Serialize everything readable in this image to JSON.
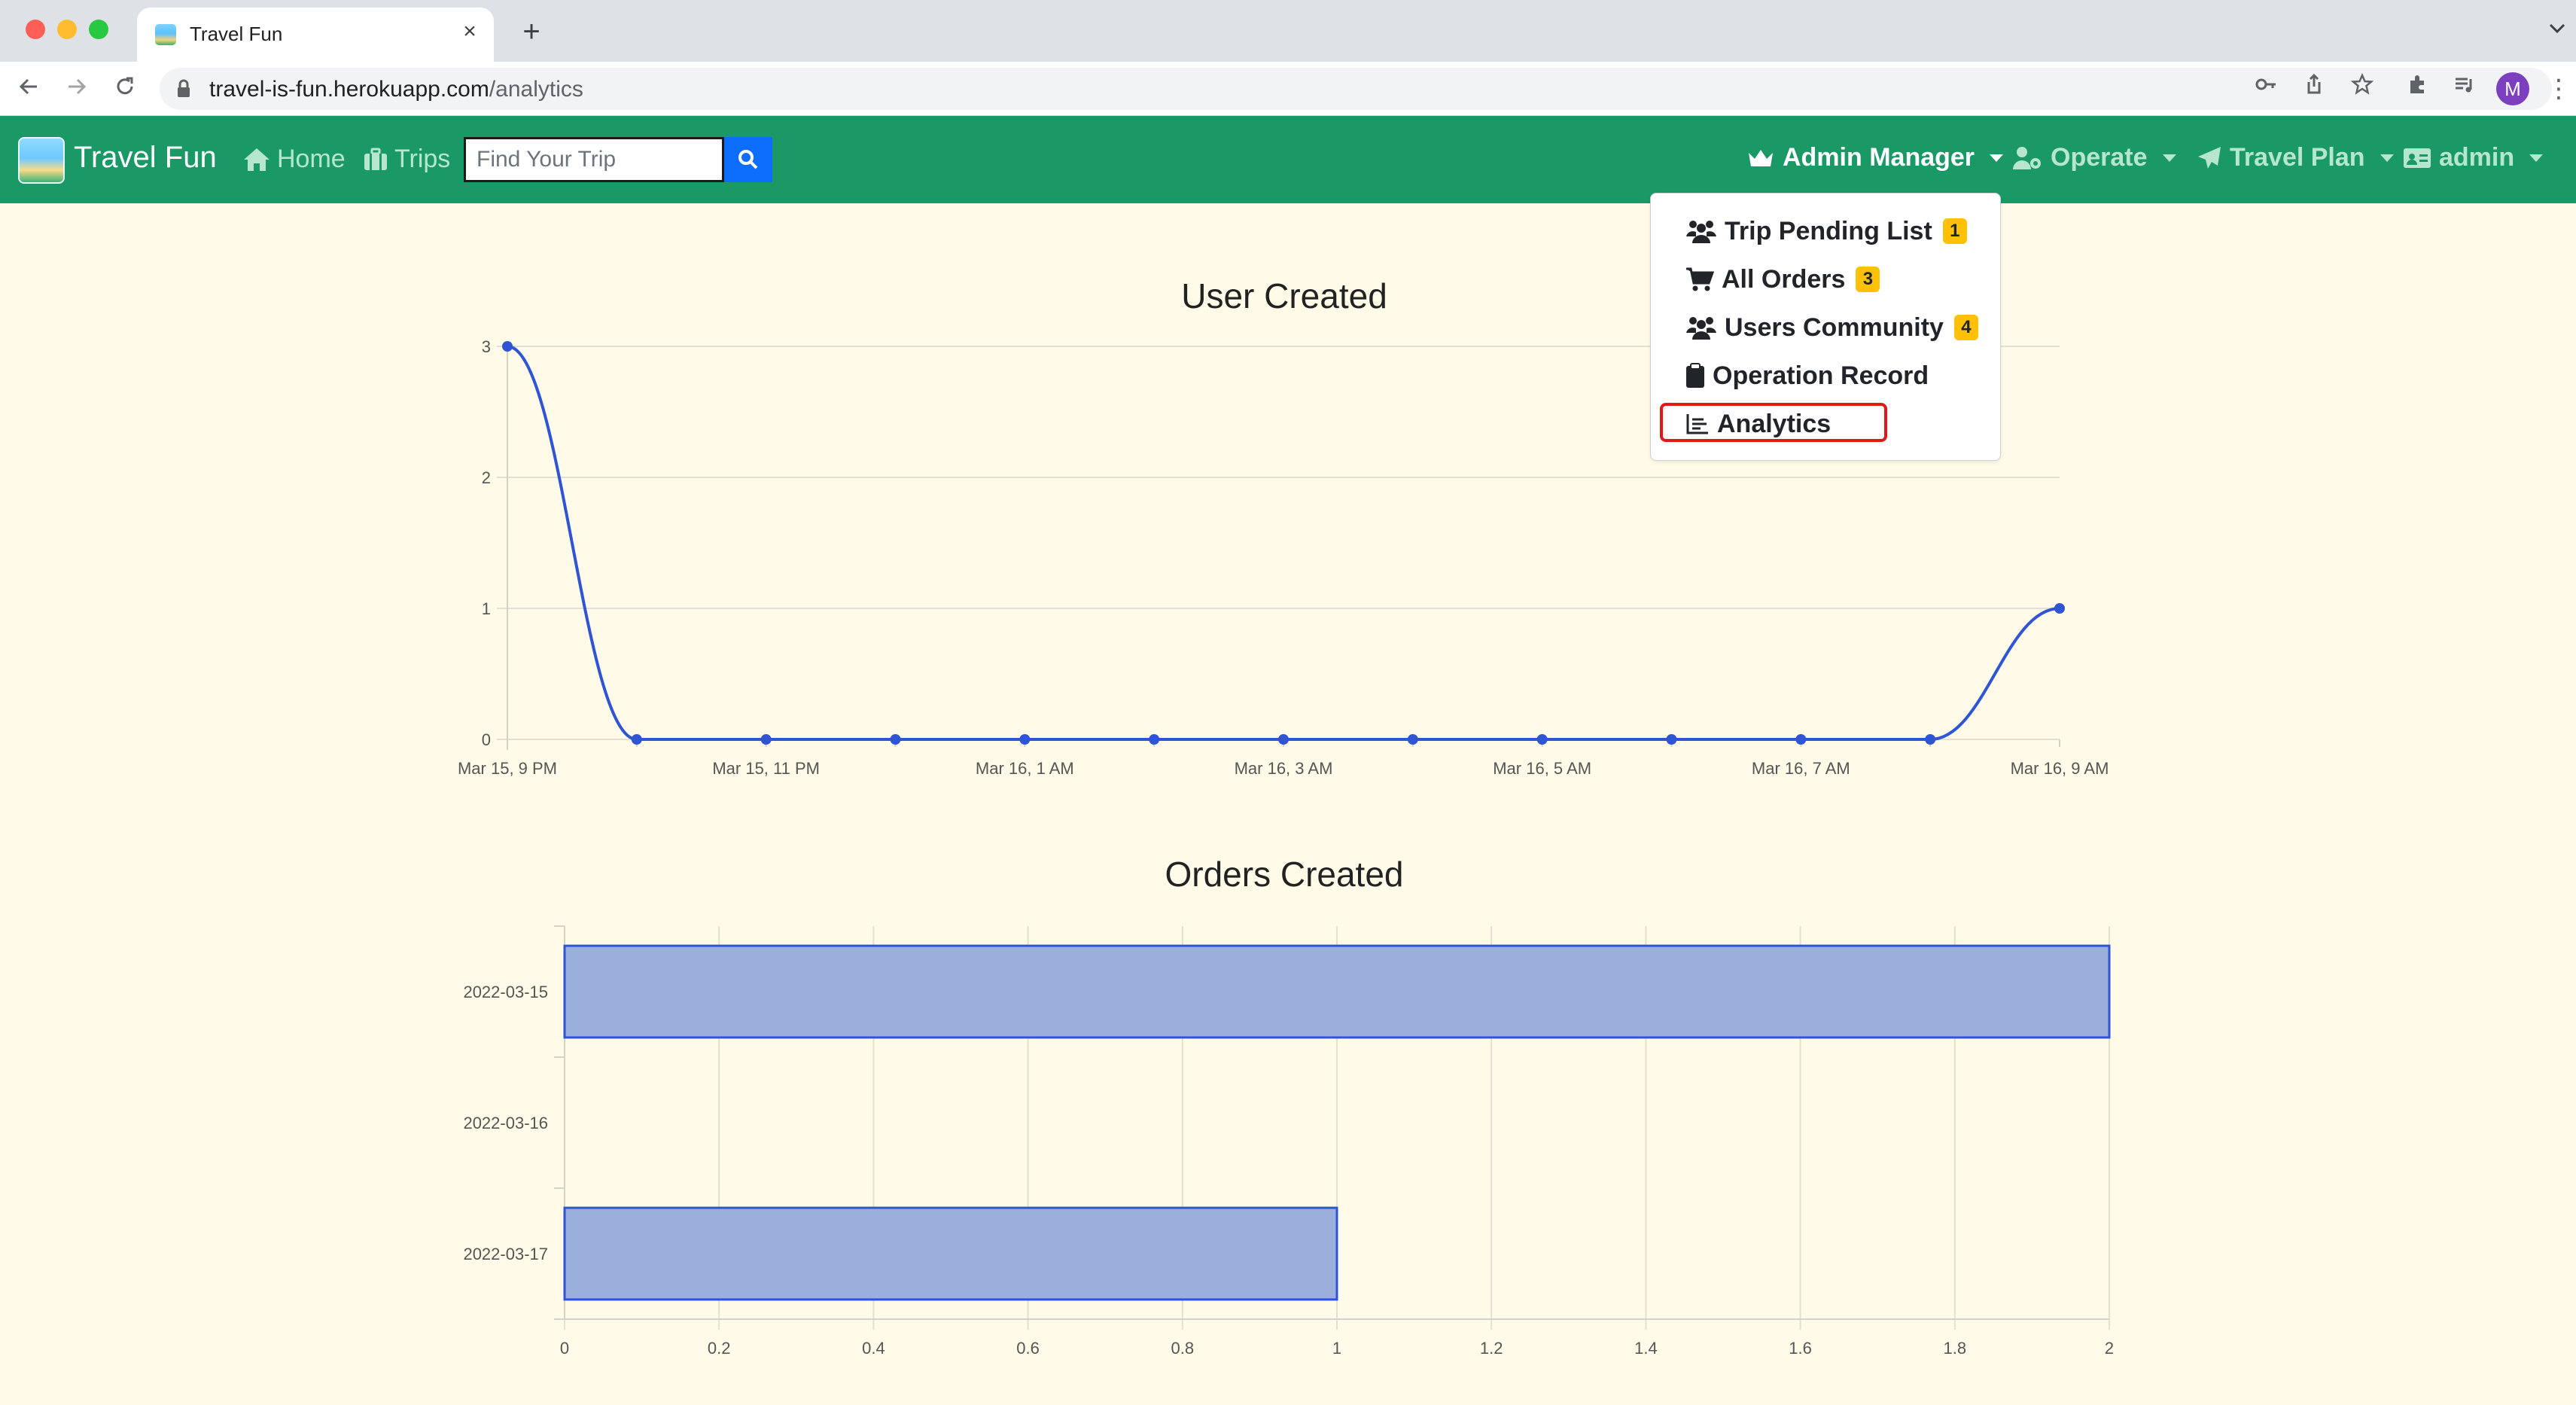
{
  "browser": {
    "tab_title": "Travel Fun",
    "url_host": "travel-is-fun.herokuapp.com",
    "url_path": "/analytics",
    "profile_initial": "M",
    "traffic_colors": [
      "#ff5f57",
      "#febc2e",
      "#28c840"
    ]
  },
  "navbar": {
    "brand": "Travel Fun",
    "home_label": "Home",
    "trips_label": "Trips",
    "search_placeholder": "Find Your Trip",
    "admin_manager_label": "Admin Manager",
    "operate_label": "Operate",
    "travel_plan_label": "Travel Plan",
    "user_label": "admin",
    "bg_color": "#1a9966"
  },
  "dropdown": {
    "items": [
      {
        "label": "Trip Pending List",
        "badge": "1",
        "icon": "users-icon"
      },
      {
        "label": "All Orders",
        "badge": "3",
        "icon": "cart-icon"
      },
      {
        "label": "Users Community",
        "badge": "4",
        "icon": "users-icon"
      },
      {
        "label": "Operation Record",
        "badge": "",
        "icon": "clipboard-icon"
      },
      {
        "label": "Analytics",
        "badge": "",
        "icon": "chart-line-icon",
        "highlighted": true
      }
    ]
  },
  "chart_data": [
    {
      "type": "line",
      "title": "User Created",
      "x": [
        "Mar 15, 9 PM",
        "Mar 15, 10 PM",
        "Mar 15, 11 PM",
        "Mar 16, 12 AM",
        "Mar 16, 1 AM",
        "Mar 16, 2 AM",
        "Mar 16, 3 AM",
        "Mar 16, 4 AM",
        "Mar 16, 5 AM",
        "Mar 16, 6 AM",
        "Mar 16, 7 AM",
        "Mar 16, 8 AM",
        "Mar 16, 9 AM"
      ],
      "x_tick_labels": [
        "Mar 15, 9 PM",
        "Mar 15, 11 PM",
        "Mar 16, 1 AM",
        "Mar 16, 3 AM",
        "Mar 16, 5 AM",
        "Mar 16, 7 AM",
        "Mar 16, 9 AM"
      ],
      "values": [
        3,
        0,
        0,
        0,
        0,
        0,
        0,
        0,
        0,
        0,
        0,
        0,
        1
      ],
      "y_ticks": [
        "0",
        "1",
        "2",
        "3"
      ],
      "ylim": [
        0,
        3
      ],
      "grid": "horizontal",
      "line_color": "#2f55d4"
    },
    {
      "type": "bar",
      "orientation": "horizontal",
      "title": "Orders Created",
      "categories": [
        "2022-03-15",
        "2022-03-16",
        "2022-03-17"
      ],
      "values": [
        2,
        0,
        1
      ],
      "x_ticks": [
        "0",
        "0.2",
        "0.4",
        "0.6",
        "0.8",
        "1",
        "1.2",
        "1.4",
        "1.6",
        "1.8",
        "2"
      ],
      "xlim": [
        0,
        2
      ],
      "grid": true,
      "bar_fill": "#9bafdc",
      "bar_stroke": "#2f55d4"
    }
  ]
}
